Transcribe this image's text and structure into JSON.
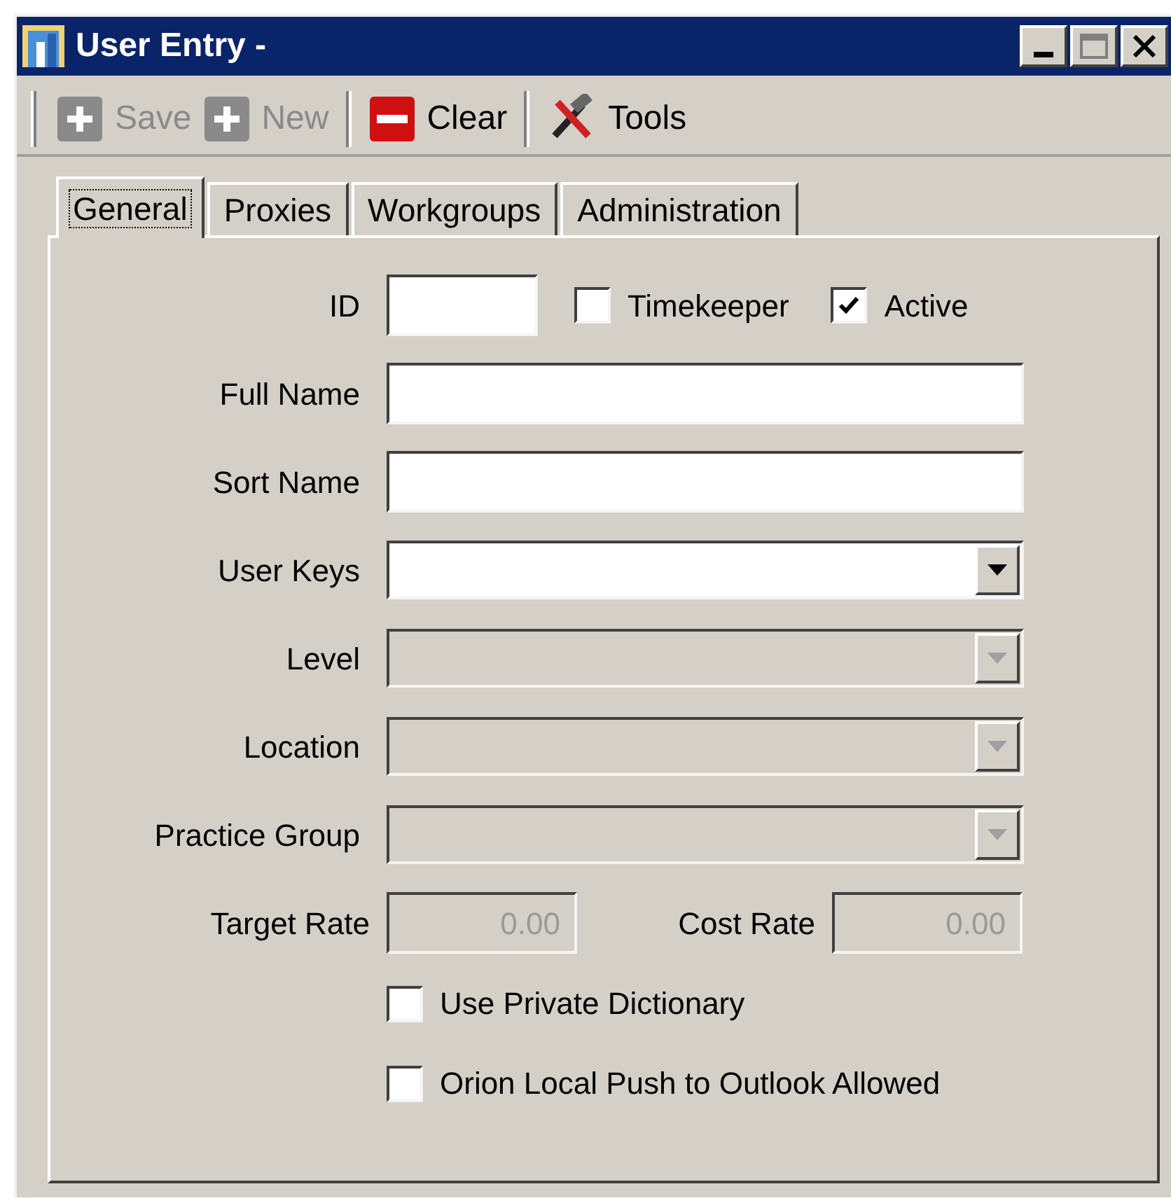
{
  "window": {
    "title": "User Entry -"
  },
  "toolbar": [
    {
      "kind": "add",
      "label": "Save",
      "disabled": true
    },
    {
      "kind": "add",
      "label": "New",
      "disabled": true
    },
    {
      "kind": "clear",
      "label": "Clear",
      "disabled": false
    },
    {
      "kind": "tools",
      "label": "Tools",
      "disabled": false
    }
  ],
  "tabs": [
    {
      "label": "General",
      "selected": true
    },
    {
      "label": "Proxies",
      "selected": false
    },
    {
      "label": "Workgroups",
      "selected": false
    },
    {
      "label": "Administration",
      "selected": false
    }
  ],
  "rows": [
    {
      "kind": "id",
      "label": "ID",
      "checkboxes": [
        {
          "label": "Timekeeper",
          "checked": false
        },
        {
          "label": "Active",
          "checked": true
        }
      ]
    },
    {
      "kind": "text",
      "label": "Full Name"
    },
    {
      "kind": "text",
      "label": "Sort Name"
    },
    {
      "kind": "combo",
      "label": "User Keys",
      "disabled": false
    },
    {
      "kind": "combo",
      "label": "Level",
      "disabled": true
    },
    {
      "kind": "combo",
      "label": "Location",
      "disabled": true
    },
    {
      "kind": "combo",
      "label": "Practice Group",
      "disabled": true
    },
    {
      "kind": "rates",
      "fields": [
        {
          "label": "Target Rate",
          "value": "0.00",
          "disabled": true
        },
        {
          "label": "Cost Rate",
          "value": "0.00",
          "disabled": true
        }
      ]
    }
  ],
  "options": [
    {
      "label": "Use Private Dictionary",
      "checked": false
    },
    {
      "label": "Orion Local Push to Outlook Allowed",
      "checked": false
    }
  ]
}
